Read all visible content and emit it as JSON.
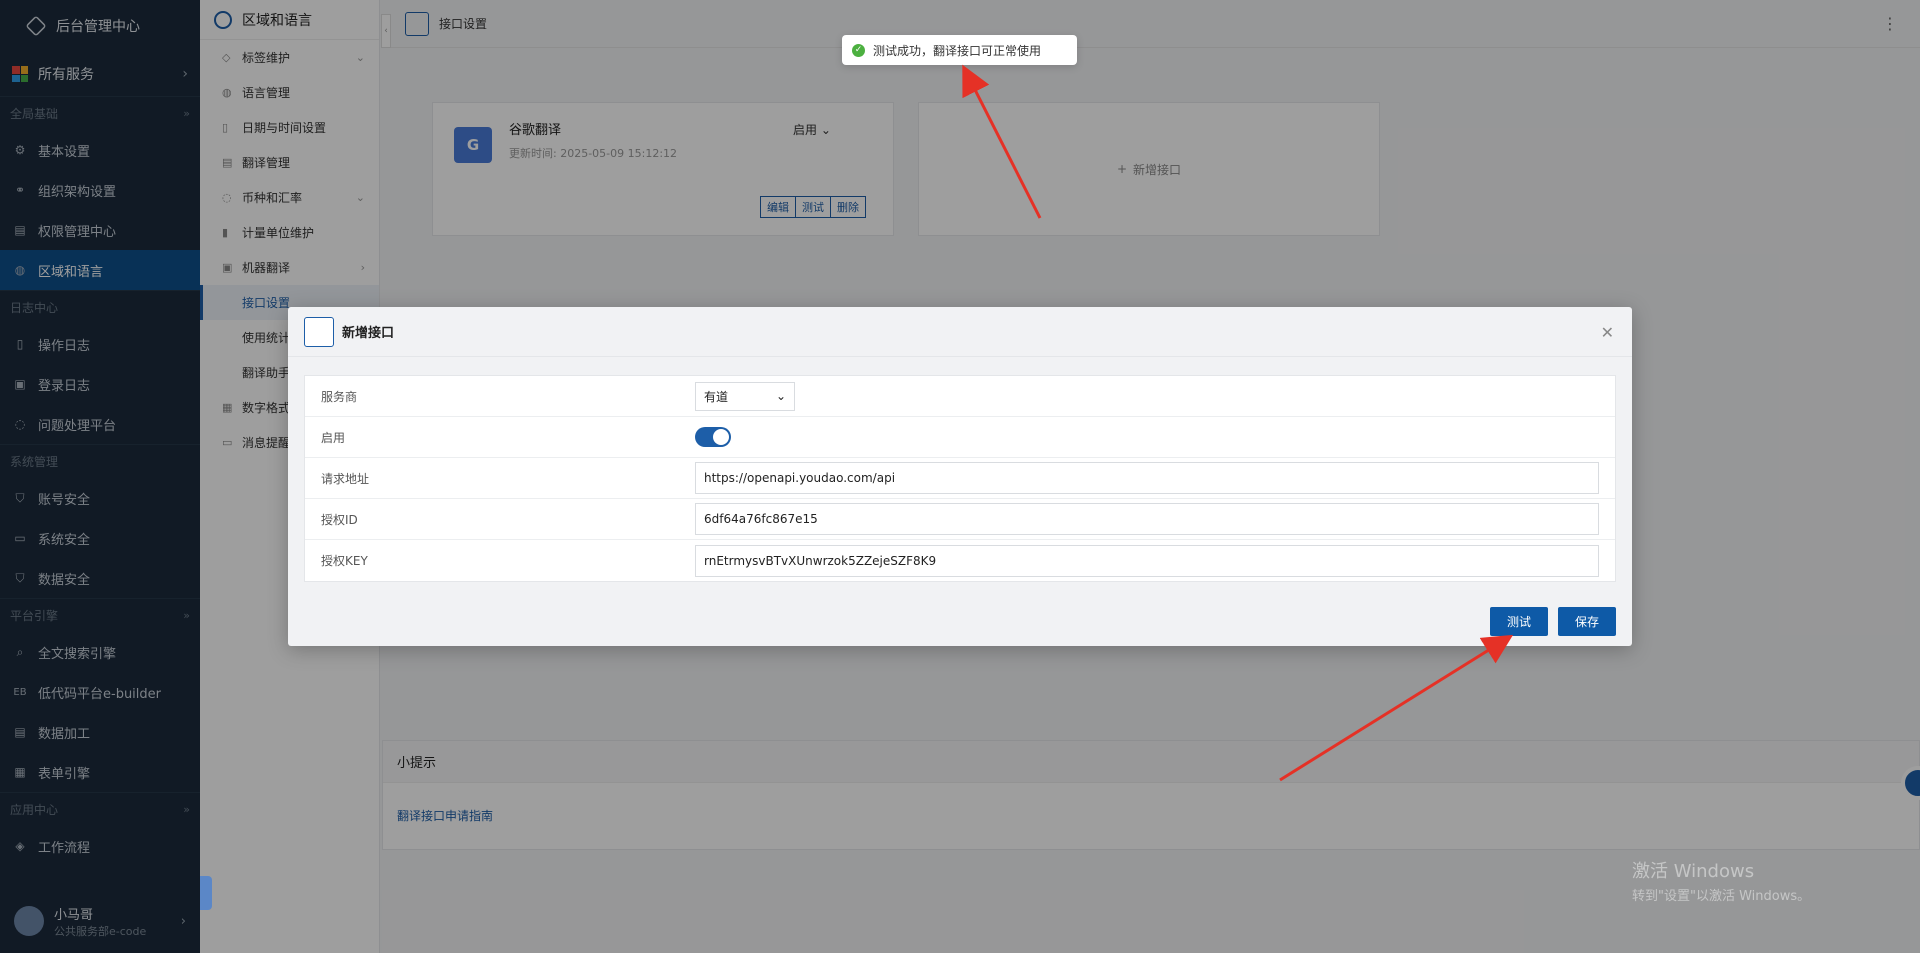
{
  "colors": {
    "accent": "#0e5aa7",
    "sidebar_bg": "#1c2b3c",
    "success": "#4cb040",
    "arrow": "#e53126"
  },
  "sidebar": {
    "brand": "后台管理中心",
    "all_services": "所有服务",
    "groups": [
      {
        "label": "全局基础",
        "items": [
          {
            "label": "基本设置",
            "icon": "gear-icon"
          },
          {
            "label": "组织架构设置",
            "icon": "org-icon"
          },
          {
            "label": "权限管理中心",
            "icon": "permission-icon"
          },
          {
            "label": "区域和语言",
            "icon": "globe-icon",
            "active": true
          }
        ]
      },
      {
        "label": "日志中心",
        "items": [
          {
            "label": "操作日志",
            "icon": "doc-icon"
          },
          {
            "label": "登录日志",
            "icon": "chart-icon"
          },
          {
            "label": "问题处理平台",
            "icon": "planet-icon"
          }
        ]
      },
      {
        "label": "系统管理",
        "items": [
          {
            "label": "账号安全",
            "icon": "shield-icon"
          },
          {
            "label": "系统安全",
            "icon": "monitor-icon"
          },
          {
            "label": "数据安全",
            "icon": "shield-icon"
          }
        ]
      },
      {
        "label": "平台引擎",
        "items": [
          {
            "label": "全文搜索引擎",
            "icon": "search-icon"
          },
          {
            "label": "低代码平台e-builder",
            "icon": "eb-icon"
          },
          {
            "label": "数据加工",
            "icon": "data-icon"
          },
          {
            "label": "表单引擎",
            "icon": "form-icon"
          }
        ]
      },
      {
        "label": "应用中心",
        "items": [
          {
            "label": "工作流程",
            "icon": "layers-icon"
          }
        ]
      }
    ],
    "user": {
      "name": "小马哥",
      "dept": "公共服务部e-code"
    }
  },
  "subnav": {
    "title": "区域和语言",
    "items": [
      {
        "label": "标签维护",
        "arrow": "⌄"
      },
      {
        "label": "语言管理"
      },
      {
        "label": "日期与时间设置"
      },
      {
        "label": "翻译管理"
      },
      {
        "label": "币种和汇率",
        "arrow": "⌄"
      },
      {
        "label": "计量单位维护"
      },
      {
        "label": "机器翻译",
        "arrow": "›"
      },
      {
        "label": "接口设置",
        "sub": true,
        "selected": true
      },
      {
        "label": "使用统计",
        "sub": true
      },
      {
        "label": "翻译助手",
        "sub": true
      },
      {
        "label": "数字格式"
      },
      {
        "label": "消息提醒"
      }
    ]
  },
  "main": {
    "page_title": "接口设置",
    "card": {
      "name": "谷歌翻译",
      "updated": "更新时间: 2025-05-09 15:12:12",
      "status": "启用",
      "actions": [
        "编辑",
        "测试",
        "删除"
      ]
    },
    "add_card_label": "新增接口",
    "tips_title": "小提示",
    "tips_link": "翻译接口申请指南"
  },
  "toast": {
    "text": "测试成功，翻译接口可正常使用"
  },
  "modal": {
    "title": "新增接口",
    "fields": {
      "provider_label": "服务商",
      "provider_value": "有道",
      "enabled_label": "启用",
      "url_label": "请求地址",
      "url_value": "https://openapi.youdao.com/api",
      "appid_label": "授权ID",
      "appid_value": "6df64a76fc867e15",
      "key_label": "授权KEY",
      "key_value": "rnEtrmysvBTvXUnwrzok5ZZejeSZF8K9"
    },
    "enabled": true,
    "test_label": "测试",
    "save_label": "保存"
  },
  "watermark": {
    "line1": "激活 Windows",
    "line2": "转到\"设置\"以激活 Windows。"
  }
}
